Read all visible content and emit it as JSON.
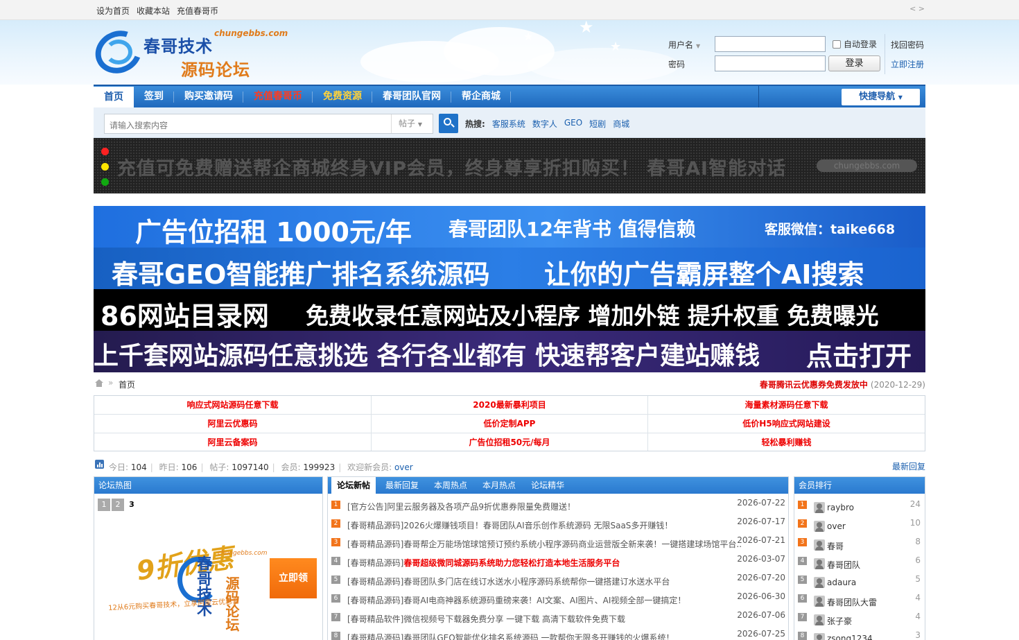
{
  "topbar": {
    "links": [
      "设为首页",
      "收藏本站",
      "充值春哥币"
    ],
    "toggle": "< >"
  },
  "logo": {
    "title": "春哥技术",
    "subtitle": "源码论坛",
    "url": "chungebbs.com"
  },
  "login": {
    "username_label": "用户名",
    "password_label": "密码",
    "auto_login": "自动登录",
    "login_button": "登录",
    "find_password": "找回密码",
    "register": "立即注册"
  },
  "nav": {
    "items": [
      {
        "label": "首页",
        "style": "active"
      },
      {
        "label": "签到",
        "style": "normal"
      },
      {
        "label": "购买邀请码",
        "style": "normal"
      },
      {
        "label": "充值春哥币",
        "style": "red"
      },
      {
        "label": "免费资源",
        "style": "gold"
      },
      {
        "label": "春哥团队官网",
        "style": "normal"
      },
      {
        "label": "帮企商城",
        "style": "normal"
      }
    ],
    "quick": "快捷导航"
  },
  "search": {
    "placeholder": "请输入搜索内容",
    "type": "帖子",
    "hot_label": "热搜:",
    "hot": [
      "客服系统",
      "数字人",
      "GEO",
      "短剧",
      "商城"
    ]
  },
  "ticker": {
    "message": "充值可免费赠送帮企商城终身VIP会员，终身尊享折扣购买！ 春哥AI智能对话",
    "tag": "chungebbs.com"
  },
  "banners": {
    "b1": [
      "广告位招租 1000元/年",
      "春哥团队12年背书 值得信赖",
      "客服微信：taike668"
    ],
    "b2": [
      "春哥GEO智能推广排名系统源码",
      "让你的广告霸屏整个AI搜索"
    ],
    "b3": [
      "86网站目录网",
      "免费收录任意网站及小程序 增加外链 提升权重 免费曝光"
    ],
    "b4": [
      "上千套网站源码任意挑选 各行各业都有 快速帮客户建站赚钱",
      "点击打开"
    ]
  },
  "breadcrumb": {
    "arrow": "»",
    "current": "首页",
    "promo_title": "春哥腾讯云优惠券免费发放中",
    "promo_date": "(2020-12-29)"
  },
  "grid_links": [
    "响应式网站源码任意下载",
    "2020最新暴利项目",
    "海量素材源码任意下载",
    "阿里云优惠码",
    "低价定制APP",
    "低价H5响应式网站建设",
    "阿里云备案码",
    "广告位招租50元/每月",
    "轻松暴利赚钱"
  ],
  "stats": {
    "today_label": "今日:",
    "today": "104",
    "yesterday_label": "昨日:",
    "yesterday": "106",
    "posts_label": "帖子:",
    "posts": "1097140",
    "members_label": "会员:",
    "members": "199923",
    "welcome_label": "欢迎新会员:",
    "newest": "over",
    "latest": "最新回复"
  },
  "hot_images": {
    "title": "论坛热图",
    "pages": [
      "1",
      "2",
      "3"
    ],
    "promo_text": "9折优惠",
    "logo_title": "春哥技术",
    "logo_subtitle": "源码论坛",
    "logo_url": "chungebbs.com",
    "caption": "12从6元购买春哥技术，立享阿里云优惠套",
    "button": "立即领"
  },
  "threads": {
    "tabs": [
      "论坛新帖",
      "最新回复",
      "本周热点",
      "本月热点",
      "论坛精华"
    ],
    "items": [
      {
        "n": "1",
        "prefix": "[官方公告]",
        "title": "阿里云服务器及各项产品9折优惠券限量免费赠送！",
        "red": false,
        "date": "2026-07-22"
      },
      {
        "n": "2",
        "prefix": "[春哥精品源码]",
        "title": "2026火爆赚钱项目！春哥团队AI音乐创作系统源码 无限SaaS多开赚钱！",
        "red": false,
        "date": "2026-07-17"
      },
      {
        "n": "3",
        "prefix": "[春哥精品源码]",
        "title": "春哥帮企万能场馆球馆预订预约系统小程序源码商业运营版全新来袭！一键搭建球场馆平台...",
        "red": false,
        "date": "2026-07-21"
      },
      {
        "n": "4",
        "prefix": "[春哥精品源码]",
        "title": "春哥超级微同城源码系统助力您轻松打造本地生活服务平台",
        "red": true,
        "date": "2026-03-07"
      },
      {
        "n": "5",
        "prefix": "[春哥精品源码]",
        "title": "春哥团队多门店在线订水送水小程序源码系统帮你一键搭建订水送水平台",
        "red": false,
        "date": "2026-07-20"
      },
      {
        "n": "6",
        "prefix": "[春哥精品源码]",
        "title": "春哥AI电商神器系统源码重磅来袭！AI文案、AI图片、AI视频全部一键搞定！",
        "red": false,
        "date": "2026-06-30"
      },
      {
        "n": "7",
        "prefix": "[春哥精品软件]",
        "title": "微信视频号下载器免费分享 一键下载 高清下载软件免费下载",
        "red": false,
        "date": "2026-07-06"
      },
      {
        "n": "8",
        "prefix": "[春哥精品源码]",
        "title": "春哥团队GEO智能优化排名系统源码 一款帮你无限多开赚钱的火爆系统！",
        "red": false,
        "date": "2026-07-25"
      }
    ]
  },
  "ranking": {
    "title": "会员排行",
    "items": [
      {
        "n": "1",
        "user": "raybro",
        "count": "24"
      },
      {
        "n": "2",
        "user": "over",
        "count": "10"
      },
      {
        "n": "3",
        "user": "春哥",
        "count": "8"
      },
      {
        "n": "4",
        "user": "春哥团队",
        "count": "6"
      },
      {
        "n": "5",
        "user": "adaura",
        "count": "5"
      },
      {
        "n": "6",
        "user": "春哥团队大雷",
        "count": "4"
      },
      {
        "n": "7",
        "user": "张子豪",
        "count": "4"
      },
      {
        "n": "8",
        "user": "zsong1234",
        "count": "3"
      }
    ]
  }
}
